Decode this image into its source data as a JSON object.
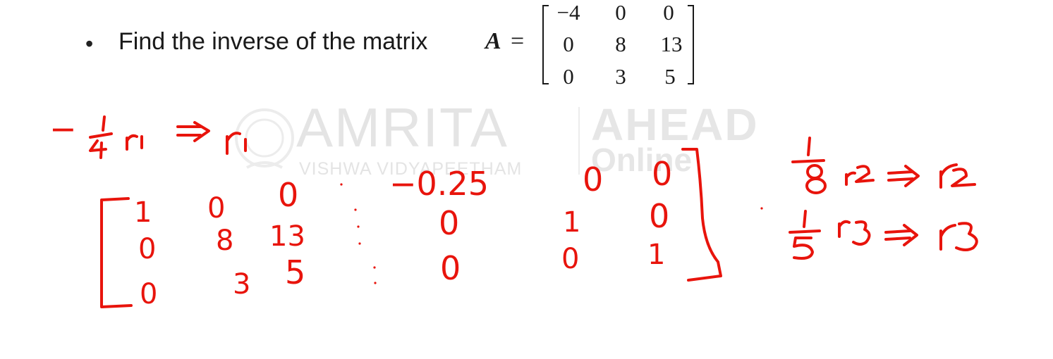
{
  "prompt": {
    "bullet": "•",
    "text": "Find the inverse of the matrix",
    "matrix_name": "A",
    "equals": "="
  },
  "matrix_A": {
    "rows": [
      [
        "−4",
        "0",
        "0"
      ],
      [
        "0",
        "8",
        "13"
      ],
      [
        "0",
        "3",
        "5"
      ]
    ]
  },
  "watermark": {
    "brand": "AMRITA",
    "subtitle": "VISHWA VIDYAPEETHAM",
    "brand2": "AHEAD",
    "brand2_sub": "Online"
  },
  "handwriting": {
    "step1": {
      "arrow": "⇒",
      "target": "r",
      "target_sub": "1",
      "minus": "−"
    },
    "augmented_rows": [
      [
        "1",
        "0",
        "0",
        "−0.25",
        "0",
        "0"
      ],
      [
        "0",
        "8",
        "13",
        "0",
        "1",
        "0"
      ],
      [
        "0",
        "3",
        "5",
        "0",
        "0",
        "1"
      ]
    ],
    "step2": {
      "arrow": "⇒",
      "r_sub": "2"
    },
    "step3": {
      "arrow": "⇒",
      "r_sub": "3"
    }
  },
  "colors": {
    "ink": "#e8140c",
    "text": "#1a1a1a",
    "watermark": "#e4e4e4"
  }
}
